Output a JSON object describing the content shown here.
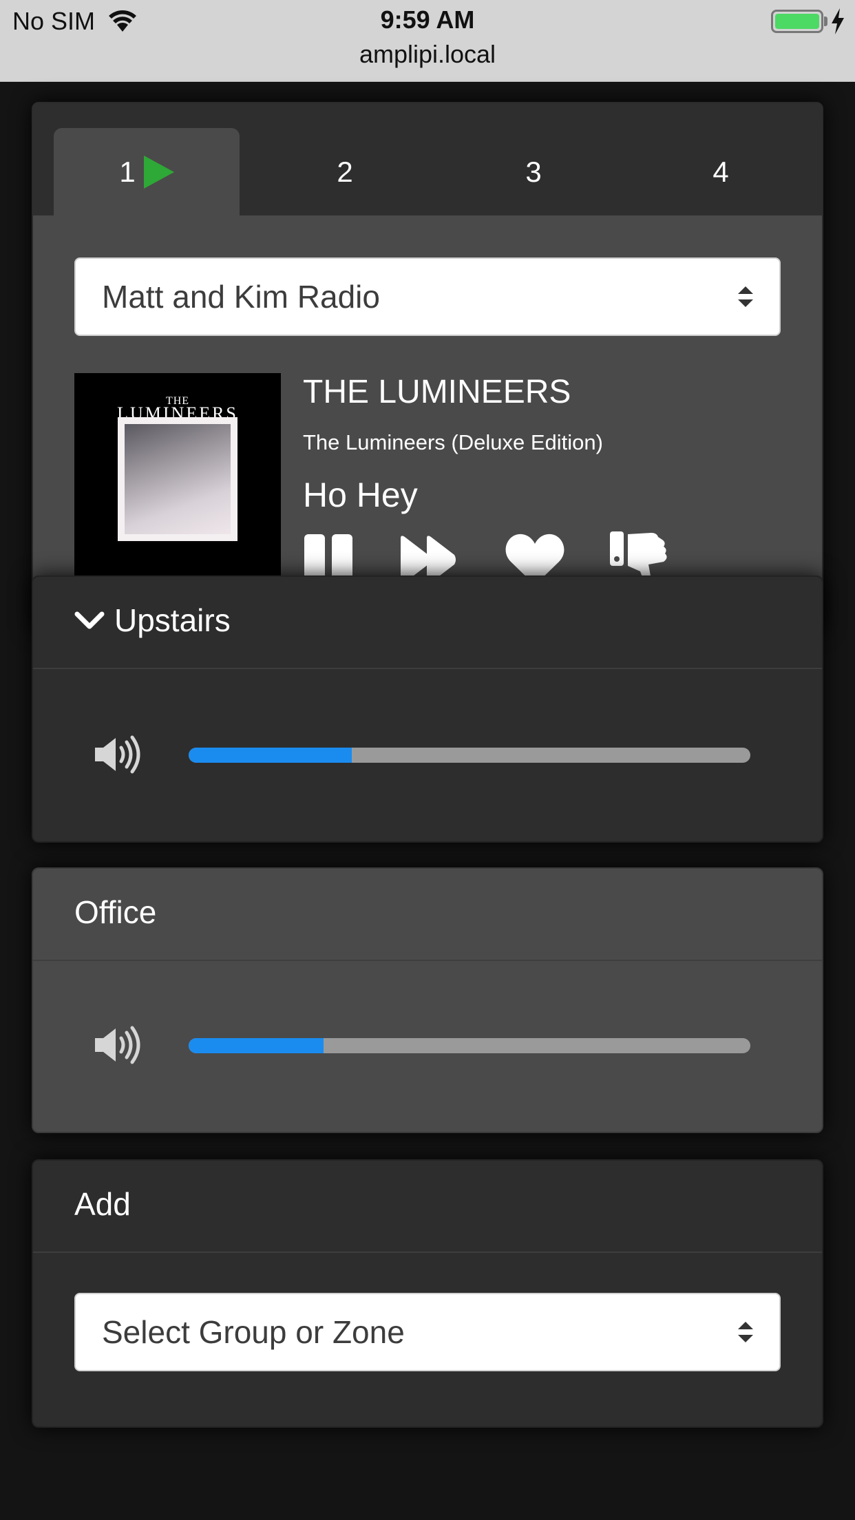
{
  "status_bar": {
    "carrier": "No SIM",
    "time": "9:59 AM",
    "url": "amplipi.local",
    "battery_color": "#4cd964"
  },
  "player": {
    "tabs": [
      {
        "label": "1",
        "active": true,
        "playing": true
      },
      {
        "label": "2",
        "active": false
      },
      {
        "label": "3",
        "active": false
      },
      {
        "label": "4",
        "active": false
      }
    ],
    "source_select": {
      "value": "Matt and Kim Radio"
    },
    "album_art": {
      "line1": "THE",
      "line2": "LUMINEERS"
    },
    "now_playing": {
      "artist": "THE LUMINEERS",
      "album": "The Lumineers (Deluxe Edition)",
      "song": "Ho Hey"
    },
    "controls": [
      "pause-icon",
      "skip-forward-icon",
      "heart-icon",
      "thumbs-down-icon"
    ],
    "accent_color": "#2ea836"
  },
  "zones": [
    {
      "title": "Upstairs",
      "collapsible": true,
      "volume": 0.29
    },
    {
      "title": "Office",
      "collapsible": false,
      "volume": 0.24
    }
  ],
  "add": {
    "title": "Add",
    "select": {
      "value": "Select Group or Zone"
    }
  },
  "colors": {
    "slider_fill": "#1a8cf0",
    "slider_track": "#9a9a9a"
  }
}
